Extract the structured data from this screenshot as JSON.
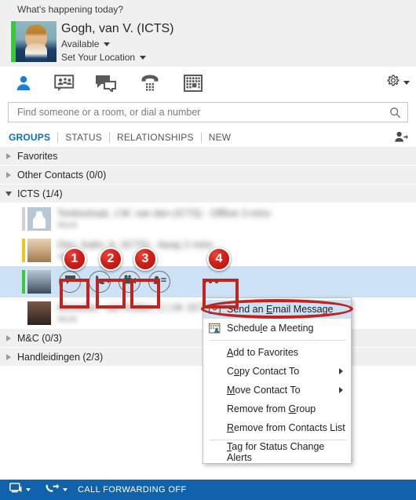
{
  "note": {
    "text": "What's happening today?"
  },
  "me": {
    "name": "Gogh, van V. (ICTS)",
    "status": "Available",
    "location": "Set Your Location",
    "presence_color": "#3cc83c",
    "avatar_name": "user-avatar"
  },
  "toolbar": {
    "items": [
      {
        "icon": "contacts-icon",
        "name": "tab-contacts",
        "active": true
      },
      {
        "icon": "chat-rooms-icon",
        "name": "tab-chat-rooms",
        "active": false
      },
      {
        "icon": "conversations-icon",
        "name": "tab-conversations",
        "active": false
      },
      {
        "icon": "phone-dialpad-icon",
        "name": "tab-phone",
        "active": false
      },
      {
        "icon": "calendar-icon",
        "name": "tab-meetings",
        "active": false
      }
    ],
    "options_icon": "gear-icon",
    "accent_color": "#0f6cbd"
  },
  "search": {
    "placeholder": "Find someone or a room, or dial a number",
    "value": "",
    "icon": "search-icon"
  },
  "tabs": {
    "items": [
      {
        "label": "GROUPS",
        "active": true
      },
      {
        "label": "STATUS",
        "active": false
      },
      {
        "label": "RELATIONSHIPS",
        "active": false
      },
      {
        "label": "NEW",
        "active": false
      }
    ],
    "add_contact_icon": "add-contact-icon",
    "active_color": "#0f6cbd"
  },
  "groups": [
    {
      "label": "Favorites",
      "expanded": false
    },
    {
      "label": "Other Contacts (0/0)",
      "expanded": false
    },
    {
      "label": "ICTS (1/4)",
      "expanded": true
    },
    {
      "label": "M&C (0/3)",
      "expanded": false
    },
    {
      "label": "Handleidingen (2/3)",
      "expanded": false
    }
  ],
  "contacts": [
    {
      "name": "",
      "sub": "",
      "presence_color": "#c9c9c9",
      "selected": false,
      "avatar": "generic"
    },
    {
      "name": "",
      "sub": "",
      "presence_color": "#f0c419",
      "selected": false,
      "avatar": "photo-blonde"
    },
    {
      "name": "",
      "sub": "",
      "presence_color": "#3cc83c",
      "selected": true,
      "avatar": "photo-man"
    },
    {
      "name": "",
      "sub": "",
      "presence_color": "#ffffff",
      "selected": false,
      "avatar": "photo-dark"
    }
  ],
  "actions": {
    "items": [
      {
        "icon": "chat-bubble-icon",
        "name": "send-im-button",
        "badge": "1",
        "boxed": true,
        "caret": false
      },
      {
        "icon": "phone-icon",
        "name": "call-button",
        "badge": "2",
        "boxed": true,
        "caret": true
      },
      {
        "icon": "video-camera-icon",
        "name": "video-call-button",
        "badge": "3",
        "boxed": true,
        "caret": false
      },
      {
        "icon": "contact-card-icon",
        "name": "contact-card-button",
        "badge": "",
        "boxed": false,
        "caret": false
      },
      {
        "icon": "more-options-icon",
        "name": "more-options-button",
        "badge": "4",
        "boxed": true,
        "caret": false
      }
    ],
    "highlight_color": "#c0241c"
  },
  "context_menu": {
    "items": [
      {
        "label": "Send an Email Message",
        "accel": "E",
        "icon": "envelope-icon",
        "highlight": true,
        "submenu": false,
        "sep_after": false
      },
      {
        "label": "Schedule a Meeting",
        "accel": "l",
        "icon": "calendar-person-icon",
        "highlight": false,
        "submenu": false,
        "sep_after": true
      },
      {
        "label": "Add to Favorites",
        "accel": "A",
        "icon": "",
        "highlight": false,
        "submenu": false,
        "sep_after": false
      },
      {
        "label": "Copy Contact To",
        "accel": "o",
        "icon": "",
        "highlight": false,
        "submenu": true,
        "sep_after": false
      },
      {
        "label": "Move Contact To",
        "accel": "M",
        "icon": "",
        "highlight": false,
        "submenu": true,
        "sep_after": false
      },
      {
        "label": "Remove from Group",
        "accel": "G",
        "icon": "",
        "highlight": false,
        "submenu": false,
        "sep_after": false
      },
      {
        "label": "Remove from Contacts List",
        "accel": "R",
        "icon": "",
        "highlight": false,
        "submenu": false,
        "sep_after": true
      },
      {
        "label": "Tag for Status Change Alerts",
        "accel": "T",
        "icon": "",
        "highlight": false,
        "submenu": false,
        "sep_after": false
      }
    ]
  },
  "statusbar": {
    "text": "CALL FORWARDING OFF",
    "bg_color": "#0f62ab",
    "device_icon": "monitor-speaker-icon",
    "forward_icon": "call-forward-icon"
  }
}
